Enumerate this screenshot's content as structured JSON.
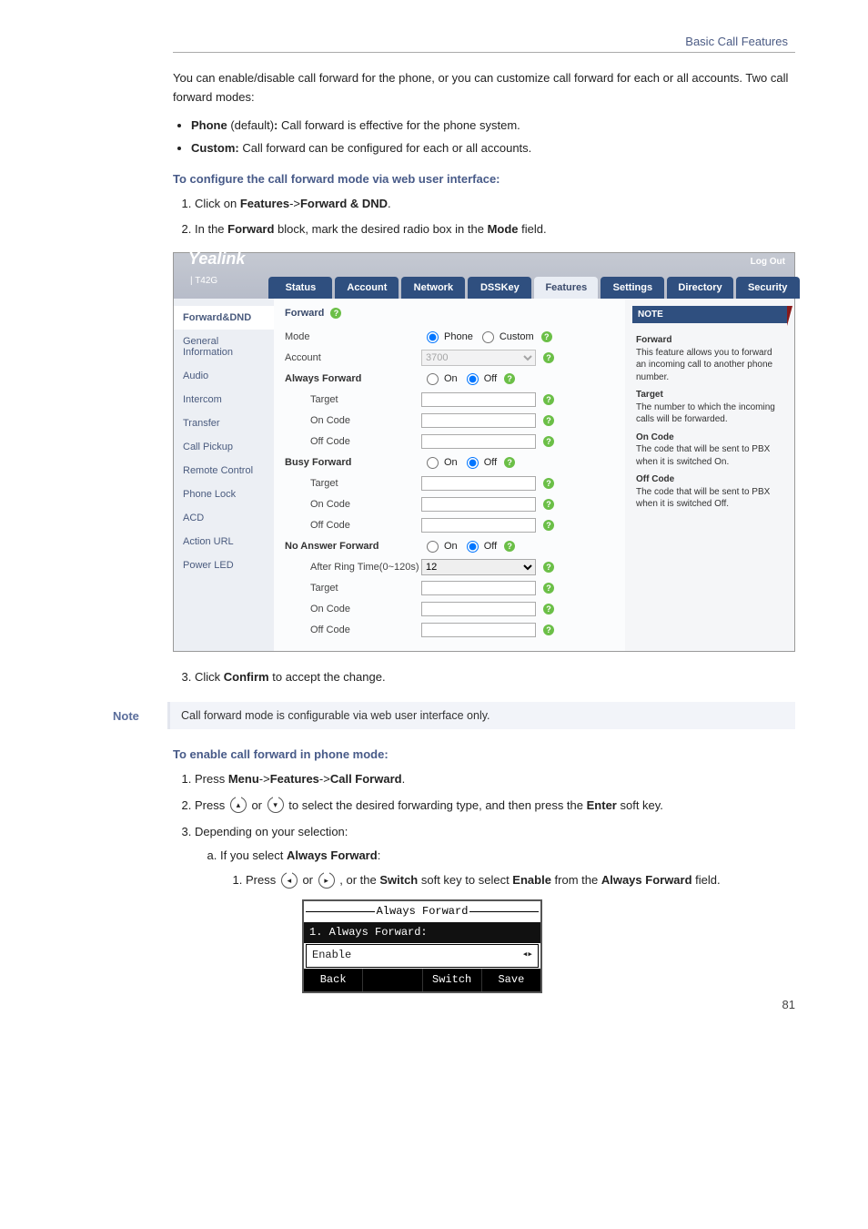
{
  "header": {
    "running": "Basic Call Features"
  },
  "footer": {
    "page": "81"
  },
  "intro": {
    "p1": "You can enable/disable call forward for the phone, or you can customize call forward for each or all accounts. Two call forward modes:",
    "b1_label": "Phone",
    "b1_default": " (default)",
    "b1_rest": ": Call forward is effective for the phone system.",
    "b2_label": "Custom:",
    "b2_rest": " Call forward can be configured for each or all accounts."
  },
  "sec1": {
    "head": "To configure the call forward mode via web user interface:",
    "s1a": "Click on ",
    "s1b": "Features",
    "s1c": "->",
    "s1d": "Forward & DND",
    "s1e": ".",
    "s2a": "In the ",
    "s2b": "Forward",
    "s2c": " block, mark the desired radio box in the ",
    "s2d": "Mode",
    "s2e": " field.",
    "s3a": "Click ",
    "s3b": "Confirm",
    "s3c": " to accept the change."
  },
  "web": {
    "brand": "Yealink",
    "model": "T42G",
    "logout": "Log Out",
    "tabs": [
      "Status",
      "Account",
      "Network",
      "DSSKey",
      "Features",
      "Settings",
      "Directory",
      "Security"
    ],
    "active_tab": 4,
    "side": [
      "Forward&DND",
      "General Information",
      "Audio",
      "Intercom",
      "Transfer",
      "Call Pickup",
      "Remote Control",
      "Phone Lock",
      "ACD",
      "Action URL",
      "Power LED"
    ],
    "side_active": 0,
    "form": {
      "title": "Forward",
      "rows": [
        {
          "label": "Mode",
          "type": "radio",
          "opts": [
            "Phone",
            "Custom"
          ],
          "sel": 0
        },
        {
          "label": "Account",
          "type": "select",
          "value": "3700"
        },
        {
          "label": "Always Forward",
          "type": "group",
          "opts": [
            "On",
            "Off"
          ],
          "sel": 1
        },
        {
          "label": "Target",
          "type": "text",
          "value": "",
          "sub": true
        },
        {
          "label": "On Code",
          "type": "text",
          "value": "",
          "sub": true
        },
        {
          "label": "Off Code",
          "type": "text",
          "value": "",
          "sub": true
        },
        {
          "label": "Busy Forward",
          "type": "group",
          "opts": [
            "On",
            "Off"
          ],
          "sel": 1
        },
        {
          "label": "Target",
          "type": "text",
          "value": "",
          "sub": true
        },
        {
          "label": "On Code",
          "type": "text",
          "value": "",
          "sub": true
        },
        {
          "label": "Off Code",
          "type": "text",
          "value": "",
          "sub": true
        },
        {
          "label": "No Answer Forward",
          "type": "group",
          "opts": [
            "On",
            "Off"
          ],
          "sel": 1
        },
        {
          "label": "After Ring Time(0~120s)",
          "type": "select",
          "value": "12",
          "sub": true
        },
        {
          "label": "Target",
          "type": "text",
          "value": "",
          "sub": true
        },
        {
          "label": "On Code",
          "type": "text",
          "value": "",
          "sub": true
        },
        {
          "label": "Off Code",
          "type": "text",
          "value": "",
          "sub": true
        }
      ]
    },
    "note": {
      "head": "NOTE",
      "items": [
        {
          "t": "Forward",
          "b": "This feature allows you to forward an incoming call to another phone number."
        },
        {
          "t": "Target",
          "b": "The number to which the incoming calls will be forwarded."
        },
        {
          "t": "On Code",
          "b": "The code that will be sent to PBX when it is switched On."
        },
        {
          "t": "Off Code",
          "b": "The code that will be sent to PBX when it is switched Off."
        }
      ]
    }
  },
  "note": {
    "label": "Note",
    "body": "Call forward mode is configurable via web user interface only."
  },
  "sec2": {
    "head": "To enable call forward in phone mode:",
    "s1a": "Press ",
    "s1b": "Menu",
    "s1c": "->",
    "s1d": "Features",
    "s1e": "->",
    "s1f": "Call Forward",
    "s1g": ".",
    "s2a": "Press ",
    "s2b": " or ",
    "s2c": " to select the desired forwarding type, and then press the ",
    "s2d": "Enter",
    "s2e": " soft key.",
    "s3": "Depending on your selection:",
    "a_a": "If you select ",
    "a_b": "Always Forward",
    "a_c": ":",
    "a1a": "Press ",
    "a1b": " or ",
    "a1c": " , or the ",
    "a1d": "Switch",
    "a1e": " soft key to select ",
    "a1f": "Enable",
    "a1g": " from the ",
    "a1h": "Always Forward",
    "a1i": " field."
  },
  "phone": {
    "title": "Always Forward",
    "row1": "1. Always Forward:",
    "row2": "Enable",
    "arrows": "◂▸",
    "sk": [
      "Back",
      "",
      "Switch",
      "Save"
    ]
  }
}
